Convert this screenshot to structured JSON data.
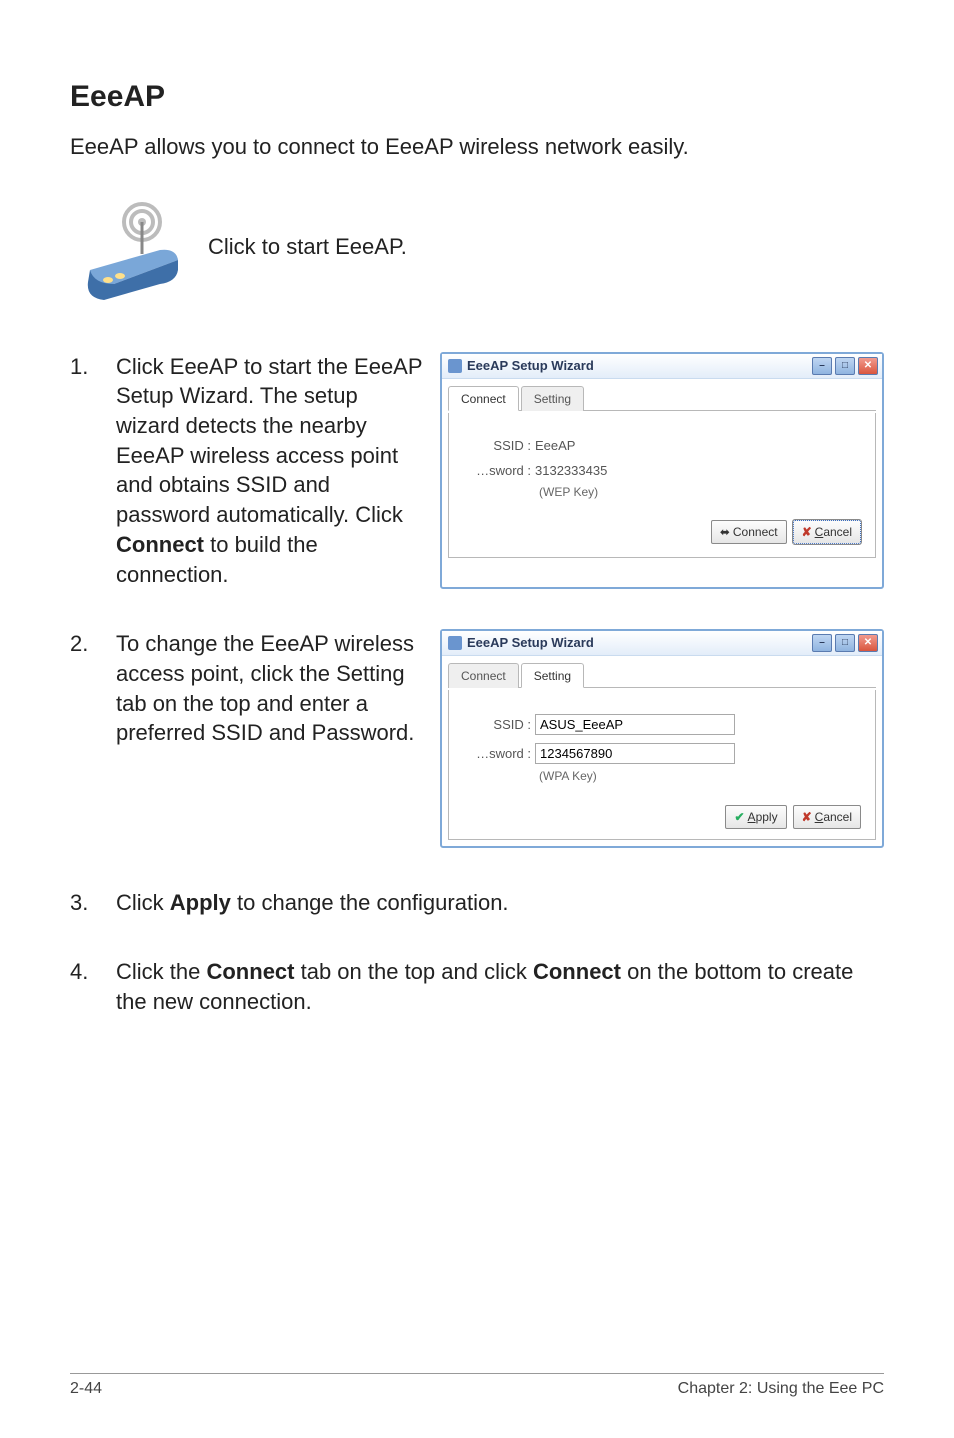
{
  "title": "EeeAP",
  "intro": "EeeAP allows you to connect to EeeAP wireless network easily.",
  "icon_caption": "Click to start EeeAP.",
  "steps": {
    "s1": {
      "num": "1.",
      "pre": "Click EeeAP to start the EeeAP Setup Wizard. The setup wizard detects the nearby EeeAP wireless access point and obtains SSID and password automatically. Click ",
      "bold": "Connect",
      "post": " to build the connection."
    },
    "s2": {
      "num": "2.",
      "text": "To change the EeeAP wireless access point, click the Setting tab on the top and enter a preferred SSID and Password."
    },
    "s3": {
      "num": "3.",
      "pre": "Click ",
      "bold": "Apply",
      "post": " to change the configuration."
    },
    "s4": {
      "num": "4.",
      "pre": "Click the ",
      "bold1": "Connect",
      "mid": " tab on the top and click ",
      "bold2": "Connect",
      "post": " on the bottom to create the new connection."
    }
  },
  "window1": {
    "title": "EeeAP Setup Wizard",
    "tab_connect": "Connect",
    "tab_setting": "Setting",
    "ssid_label": "SSID :",
    "ssid_value": "EeeAP",
    "pw_label": "…sword :",
    "pw_value": "3132333435",
    "hint": "(WEP Key)",
    "btn_connect_icon": "⬌",
    "btn_connect": "Connect",
    "btn_cancel_icon": "✘",
    "btn_cancel_u": "C",
    "btn_cancel_rest": "ancel"
  },
  "window2": {
    "title": "EeeAP Setup Wizard",
    "tab_connect": "Connect",
    "tab_setting": "Setting",
    "ssid_label": "SSID :",
    "ssid_value": "ASUS_EeeAP",
    "pw_label": "…sword :",
    "pw_value": "1234567890",
    "hint": "(WPA Key)",
    "btn_apply_icon": "✔",
    "btn_apply_u": "A",
    "btn_apply_rest": "pply",
    "btn_cancel_icon": "✘",
    "btn_cancel_u": "C",
    "btn_cancel_rest": "ancel"
  },
  "footer": {
    "left": "2-44",
    "right": "Chapter 2: Using the Eee PC"
  }
}
